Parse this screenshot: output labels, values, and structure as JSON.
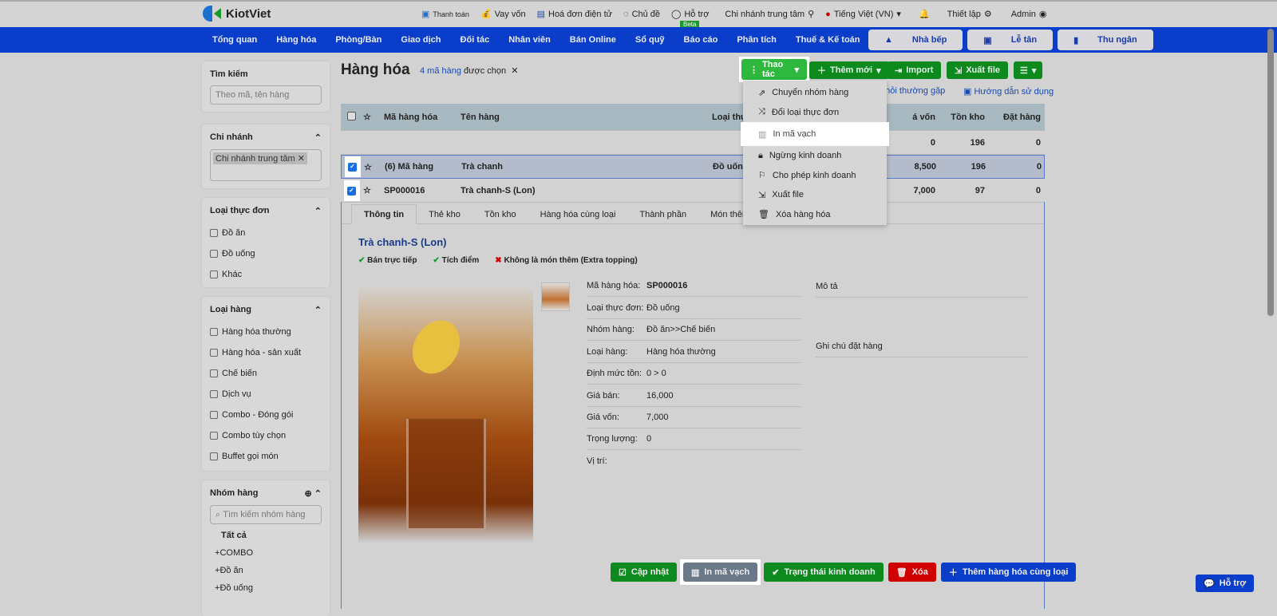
{
  "brand": "KiotViet",
  "top": {
    "links": [
      "Thanh toán",
      "Vay vốn",
      "Hoá đơn điện tử",
      "Chủ đề",
      "Hỗ trợ",
      "Chi nhánh trung tâm",
      "Tiếng Việt (VN)",
      "Thiết lập",
      "Admin"
    ],
    "beta": "Beta"
  },
  "nav": {
    "items": [
      "Tổng quan",
      "Hàng hóa",
      "Phòng/Bàn",
      "Giao dịch",
      "Đối tác",
      "Nhân viên",
      "Bán Online",
      "Sổ quỹ",
      "Báo cáo",
      "Phân tích",
      "Thuế & Kế toán"
    ],
    "buttons": [
      "Nhà bếp",
      "Lễ tân",
      "Thu ngân"
    ]
  },
  "sidebar": {
    "search": {
      "title": "Tìm kiếm",
      "placeholder": "Theo mã, tên hàng"
    },
    "branch": {
      "title": "Chi nhánh",
      "tag": "Chi nhánh trung tâm"
    },
    "menu_type": {
      "title": "Loại thực đơn",
      "items": [
        "Đồ ăn",
        "Đồ uống",
        "Khác"
      ]
    },
    "goods_type": {
      "title": "Loại hàng",
      "items": [
        "Hàng hóa thường",
        "Hàng hóa - sản xuất",
        "Chế biến",
        "Dịch vụ",
        "Combo - Đóng gói",
        "Combo tùy chọn",
        "Buffet gọi món"
      ]
    },
    "groups": {
      "title": "Nhóm hàng",
      "placeholder": "Tìm kiếm nhóm hàng",
      "items": [
        "Tất cả",
        "COMBO",
        "Đồ ăn",
        "Đồ uống"
      ]
    }
  },
  "page": {
    "title": "Hàng hóa",
    "selected_link": "4 mã hàng",
    "selected_text": "được chọn",
    "actions": {
      "thao_tac": "Thao tác",
      "them_moi": "Thêm mới",
      "import": "Import",
      "xuat_file": "Xuất file"
    },
    "help": {
      "faq": "u hỏi thường gặp",
      "guide": "Hướng dẫn sử dụng"
    }
  },
  "menu": [
    "Chuyển nhóm hàng",
    "Đổi loại thực đơn",
    "In mã vạch",
    "Ngừng kinh doanh",
    "Cho phép kinh doanh",
    "Xuất file",
    "Xóa hàng hóa"
  ],
  "table": {
    "headers": [
      "Mã hàng hóa",
      "Tên hàng",
      "Loại thự",
      "á vốn",
      "Tồn kho",
      "Đặt hàng"
    ],
    "summary": {
      "cost": "0",
      "stock": "196",
      "order": "0"
    },
    "rows": [
      {
        "code": "(6) Mã hàng",
        "name": "Trà chanh",
        "type": "Đồ uống",
        "cost": "8,500",
        "stock": "196",
        "order": "0"
      },
      {
        "code": "SP000016",
        "name": "Trà chanh-S (Lon)",
        "type": "",
        "cost": "7,000",
        "stock": "97",
        "order": "0"
      }
    ]
  },
  "detail": {
    "tabs": [
      "Thông tin",
      "Thẻ kho",
      "Tồn kho",
      "Hàng hóa cùng loại",
      "Thành phần",
      "Món thêm"
    ],
    "name": "Trà chanh-S (Lon)",
    "flags": [
      "Bán trực tiếp",
      "Tích điểm",
      "Không là món thêm (Extra topping)"
    ],
    "fields": [
      [
        "Mã hàng hóa:",
        "SP000016"
      ],
      [
        "Loại thực đơn:",
        "Đồ uống"
      ],
      [
        "Nhóm hàng:",
        "Đồ ăn>>Chế biến"
      ],
      [
        "Loại hàng:",
        "Hàng hóa thường"
      ],
      [
        "Định mức tồn:",
        "0 > 0"
      ],
      [
        "Giá bán:",
        "16,000"
      ],
      [
        "Giá vốn:",
        "7,000"
      ],
      [
        "Trọng lượng:",
        "0"
      ],
      [
        "Vị trí:",
        ""
      ]
    ],
    "desc": "Mô tả",
    "note": "Ghi chú đặt hàng",
    "buttons": [
      "Cập nhật",
      "In mã vạch",
      "Trạng thái kinh doanh",
      "Xóa",
      "Thêm hàng hóa cùng loại"
    ]
  },
  "support": "Hỗ trợ"
}
